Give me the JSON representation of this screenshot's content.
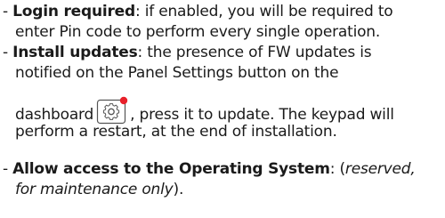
{
  "items": [
    {
      "bullet": "- ",
      "term": "Login required",
      "desc_line1": ": if enabled, you will be required to",
      "desc_line2": "enter Pin code to perform every single operation."
    },
    {
      "bullet": "- ",
      "term": "Install updates",
      "desc_line1": ": the presence of FW updates is",
      "desc_line2": "notified on the Panel Settings button on the",
      "desc_line3a": "dashboard",
      "desc_line3b": ", press it to update. The keypad will",
      "desc_line4": "perform a restart, at the end of installation.",
      "icon": "settings-gear-icon",
      "badge_color": "#e8202a"
    },
    {
      "bullet": "- ",
      "term": "Allow access to the Operating System",
      "desc_line1a": ": (",
      "desc_line1b": "reserved,",
      "desc_line2": "for maintenance only",
      "desc_line2b": ")."
    }
  ]
}
